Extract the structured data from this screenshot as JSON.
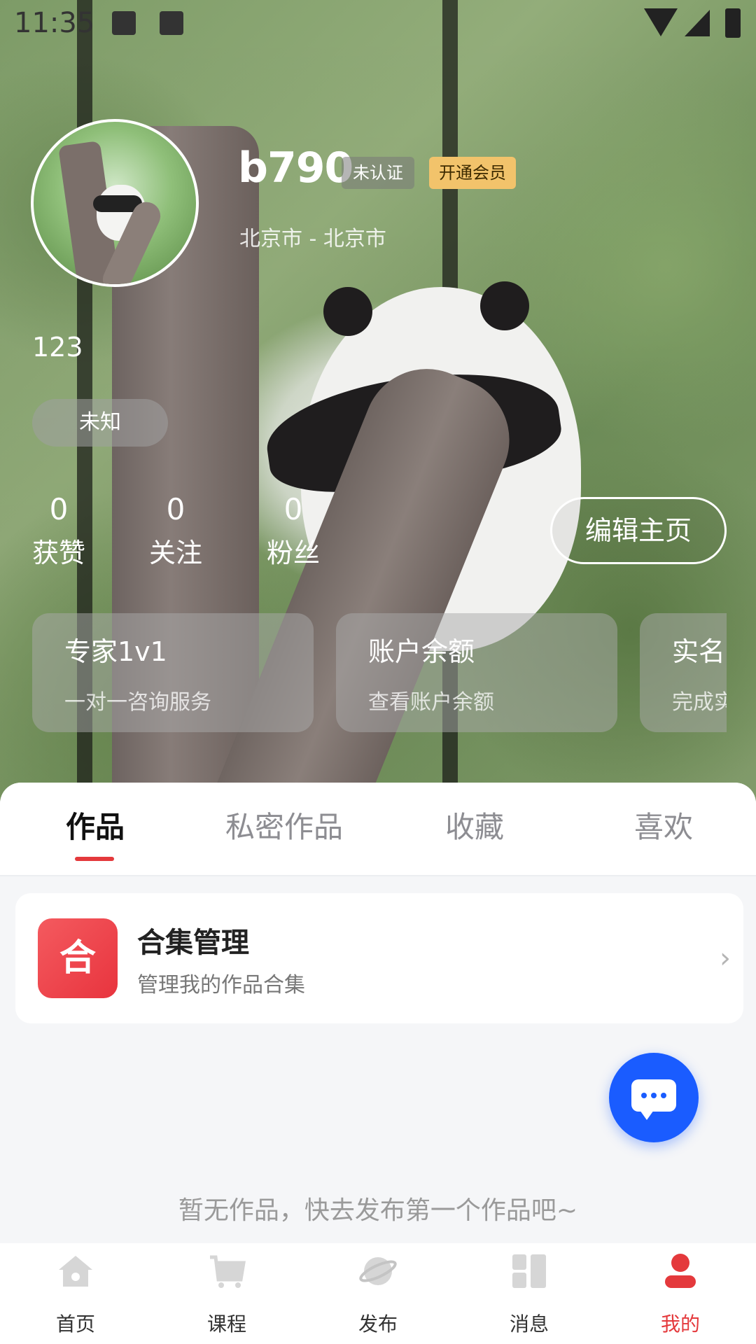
{
  "status_bar": {
    "time": "11:35"
  },
  "profile": {
    "username": "b790",
    "badge_unverified": "未认证",
    "badge_vip": "开通会员",
    "location": "北京市 - 北京市",
    "bio": "123",
    "gender": "未知",
    "edit_button": "编辑主页"
  },
  "stats": [
    {
      "value": "0",
      "label": "获赞"
    },
    {
      "value": "0",
      "label": "关注"
    },
    {
      "value": "0",
      "label": "粉丝"
    }
  ],
  "service_cards": [
    {
      "title": "专家1v1",
      "subtitle": "一对一咨询服务"
    },
    {
      "title": "账户余额",
      "subtitle": "查看账户余额"
    },
    {
      "title": "实名",
      "subtitle": "完成实"
    }
  ],
  "tabs": [
    {
      "label": "作品",
      "active": true
    },
    {
      "label": "私密作品",
      "active": false
    },
    {
      "label": "收藏",
      "active": false
    },
    {
      "label": "喜欢",
      "active": false
    }
  ],
  "collection": {
    "icon_text": "合",
    "title": "合集管理",
    "subtitle": "管理我的作品合集",
    "chevron": "›"
  },
  "empty_text": "暂无作品，快去发布第一个作品吧~",
  "bottom_nav": [
    {
      "label": "首页",
      "icon": "home-icon",
      "active": false
    },
    {
      "label": "课程",
      "icon": "cart-icon",
      "active": false
    },
    {
      "label": "发布",
      "icon": "planet-icon",
      "active": false
    },
    {
      "label": "消息",
      "icon": "grid-icon",
      "active": false
    },
    {
      "label": "我的",
      "icon": "user-icon",
      "active": true
    }
  ],
  "colors": {
    "accent": "#e4393c",
    "fab": "#1a5cff",
    "vip_badge": "#f2c36b"
  }
}
